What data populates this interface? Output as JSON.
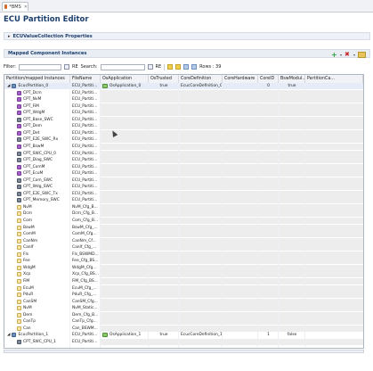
{
  "tab": {
    "label": "*BMS",
    "close": "✕"
  },
  "editor_title": "ECU Partition Editor",
  "section_props": {
    "twisty": "▸",
    "label": "ECUValueCollection Properties"
  },
  "section_mapped": {
    "label": "Mapped Component Instances"
  },
  "filter": {
    "filter_label": "Filter:",
    "search_label": "Search:",
    "re1": "RE",
    "re2": "RE",
    "rows": "Rows : 39"
  },
  "columns": [
    "Partition/mapped Instances",
    "FileName",
    "OsApplication",
    "OsTrusted",
    "CoreDefinition",
    "CoreHardware",
    "CoreID",
    "BswModul...",
    "PartitionCa..."
  ],
  "rows": [
    {
      "indent": 0,
      "icon": "part",
      "twisty": "◢",
      "name": "EcucPartition_0",
      "file": "ECU_Partiti...",
      "osapp": "OsApplication_0",
      "ostrusted": "true",
      "coredef": "EcucCoreDefinition_0",
      "corehw": "",
      "coreid": "0",
      "bsw": "true",
      "pc": "",
      "sel": true
    },
    {
      "indent": 1,
      "icon": "cpt",
      "name": "CPT_Dcm",
      "file": "ECU_Partiti..."
    },
    {
      "indent": 1,
      "icon": "cpt",
      "name": "CPT_NvM",
      "file": "ECU_Partiti..."
    },
    {
      "indent": 1,
      "icon": "cpt",
      "name": "CPT_FiM",
      "file": "ECU_Partiti..."
    },
    {
      "indent": 1,
      "icon": "cpt",
      "name": "CPT_WdgM",
      "file": "ECU_Partiti..."
    },
    {
      "indent": 1,
      "icon": "swc",
      "name": "CPT_Base_SWC",
      "file": "ECU_Partiti..."
    },
    {
      "indent": 1,
      "icon": "cpt",
      "name": "CPT_Dem",
      "file": "ECU_Partiti..."
    },
    {
      "indent": 1,
      "icon": "cpt",
      "name": "CPT_Det",
      "file": "ECU_Partiti..."
    },
    {
      "indent": 1,
      "icon": "swc",
      "name": "CPT_E2E_SWC_Rx",
      "file": "ECU_Partiti..."
    },
    {
      "indent": 1,
      "icon": "cpt",
      "name": "CPT_BswM",
      "file": "ECU_Partiti..."
    },
    {
      "indent": 1,
      "icon": "swc",
      "name": "CPT_SWC_CPU_0",
      "file": "ECU_Partiti..."
    },
    {
      "indent": 1,
      "icon": "swc",
      "name": "CPT_Diag_SWC",
      "file": "ECU_Partiti..."
    },
    {
      "indent": 1,
      "icon": "cpt",
      "name": "CPT_ComM",
      "file": "ECU_Partiti..."
    },
    {
      "indent": 1,
      "icon": "cpt",
      "name": "CPT_EcuM",
      "file": "ECU_Partiti..."
    },
    {
      "indent": 1,
      "icon": "swc",
      "name": "CPT_Com_SWC",
      "file": "ECU_Partiti..."
    },
    {
      "indent": 1,
      "icon": "swc",
      "name": "CPT_Wdg_SWC",
      "file": "ECU_Partiti..."
    },
    {
      "indent": 1,
      "icon": "swc",
      "name": "CPT_E2E_SWC_Tx",
      "file": "ECU_Partiti..."
    },
    {
      "indent": 1,
      "icon": "swc",
      "name": "CPT_Memory_SWC",
      "file": "ECU_Partiti..."
    },
    {
      "indent": 1,
      "icon": "bsw",
      "name": "NvM",
      "file": "NvM_Cfg_B..."
    },
    {
      "indent": 1,
      "icon": "bsw",
      "name": "Dcm",
      "file": "Dcm_Cfg_B..."
    },
    {
      "indent": 1,
      "icon": "bsw",
      "name": "Com",
      "file": "Com_Cfg_B..."
    },
    {
      "indent": 1,
      "icon": "bsw",
      "name": "BswM",
      "file": "BswM_Cfg_..."
    },
    {
      "indent": 1,
      "icon": "bsw",
      "name": "ComM",
      "file": "ComM_Cfg..."
    },
    {
      "indent": 1,
      "icon": "bsw",
      "name": "CanNm",
      "file": "CanNm_Cf..."
    },
    {
      "indent": 1,
      "icon": "bsw",
      "name": "CanIf",
      "file": "CanIf_Cfg_..."
    },
    {
      "indent": 1,
      "icon": "bsw",
      "name": "Fls",
      "file": "Fls_BSWMD..."
    },
    {
      "indent": 1,
      "icon": "bsw",
      "name": "Fee",
      "file": "Fee_Cfg_BS..."
    },
    {
      "indent": 1,
      "icon": "bsw",
      "name": "WdgM",
      "file": "WdgM_Cfg..."
    },
    {
      "indent": 1,
      "icon": "bsw",
      "name": "Xcp",
      "file": "Xcp_Cfg_BS..."
    },
    {
      "indent": 1,
      "icon": "bsw",
      "name": "FiM",
      "file": "FiM_Cfg_BS..."
    },
    {
      "indent": 1,
      "icon": "bsw",
      "name": "EcuM",
      "file": "EcuM_Cfg_..."
    },
    {
      "indent": 1,
      "icon": "bsw",
      "name": "PduR",
      "file": "PduR_Cfg_..."
    },
    {
      "indent": 1,
      "icon": "bsw",
      "name": "CanSM",
      "file": "CanSM_Cfg..."
    },
    {
      "indent": 1,
      "icon": "bsw",
      "name": "NvM",
      "file": "NvM_Static..."
    },
    {
      "indent": 1,
      "icon": "bsw",
      "name": "Dem",
      "file": "Dem_Cfg_B..."
    },
    {
      "indent": 1,
      "icon": "bsw",
      "name": "CanTp",
      "file": "CanTp_Cfg..."
    },
    {
      "indent": 1,
      "icon": "bsw",
      "name": "Can",
      "file": "Can_BSWM..."
    },
    {
      "indent": 0,
      "icon": "part",
      "twisty": "◢",
      "name": "EcucPartition_1",
      "file": "ECU_Partiti...",
      "osapp": "OsApplication_1",
      "ostrusted": "true",
      "coredef": "EcucCoreDefinition_1",
      "corehw": "",
      "coreid": "1",
      "bsw": "false",
      "pc": ""
    },
    {
      "indent": 1,
      "icon": "swc",
      "name": "CPT_SWC_CPU_1",
      "file": "ECU_Partiti..."
    }
  ]
}
